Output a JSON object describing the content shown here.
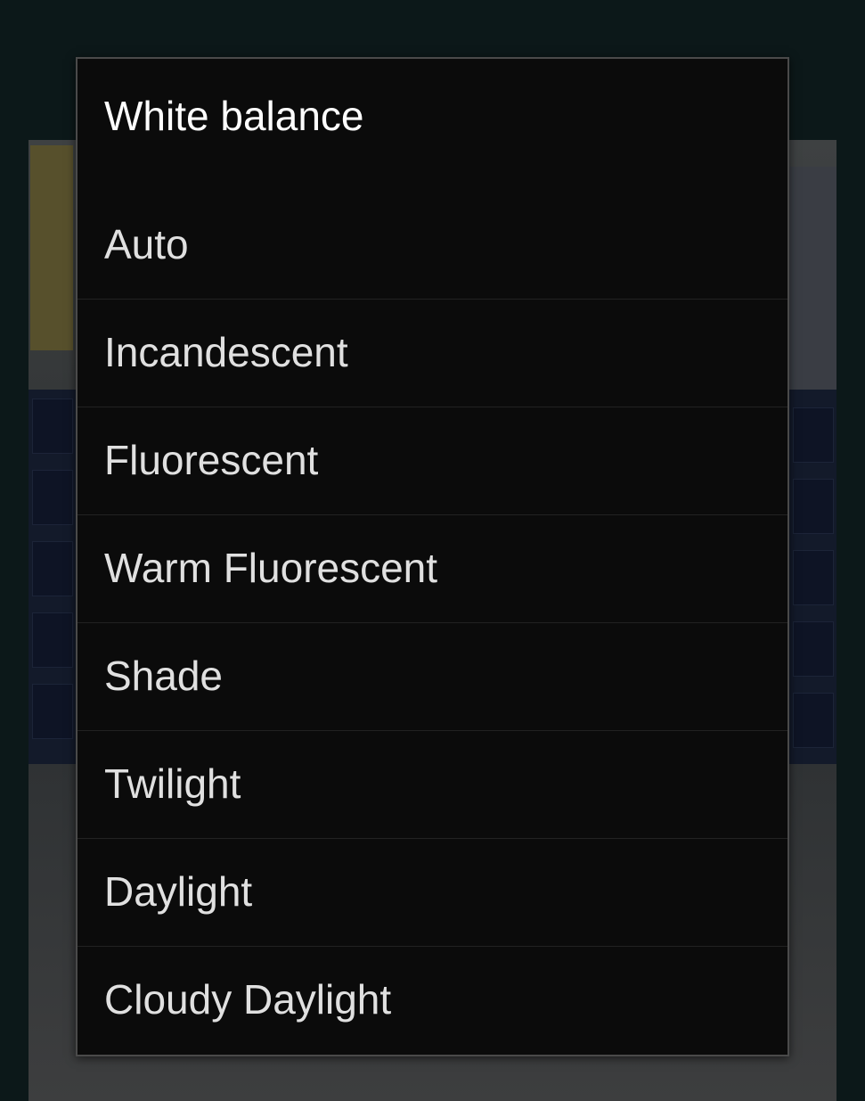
{
  "dialog": {
    "title": "White balance",
    "options": [
      {
        "label": "Auto"
      },
      {
        "label": "Incandescent"
      },
      {
        "label": "Fluorescent"
      },
      {
        "label": "Warm Fluorescent"
      },
      {
        "label": "Shade"
      },
      {
        "label": "Twilight"
      },
      {
        "label": "Daylight"
      },
      {
        "label": "Cloudy Daylight"
      }
    ]
  },
  "colors": {
    "background": "#0c1819",
    "dialog_background": "#0b0b0b",
    "title_text": "#ffffff",
    "option_text": "#e0e0e0",
    "divider": "#222222"
  }
}
